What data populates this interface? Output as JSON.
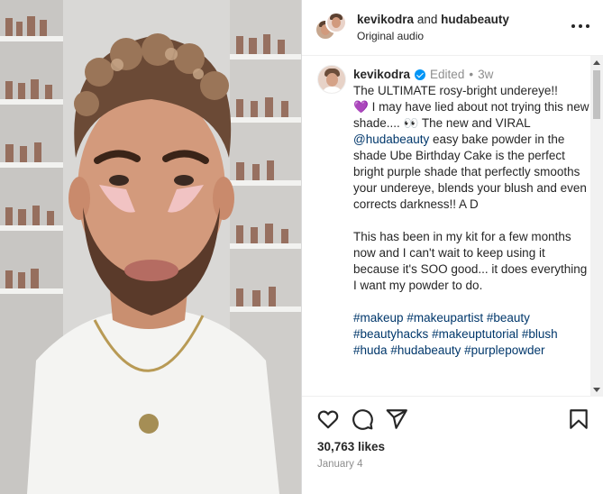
{
  "header": {
    "user1": "kevikodra",
    "connector": "and",
    "user2": "hudabeauty",
    "audio": "Original audio"
  },
  "caption": {
    "username": "kevikodra",
    "edited": "Edited",
    "dot": "•",
    "age": "3w",
    "line1": "The ULTIMATE rosy-bright undereye!!",
    "heart": "💜",
    "line2a": " I may have lied about not trying this new shade.... ",
    "eyes": "👀",
    "line2b": " The new and VIRAL ",
    "mention": "@hudabeauty",
    "line2c": " easy bake powder in the shade Ube Birthday Cake is the perfect bright purple shade that perfectly smooths your undereye, blends your blush and even corrects darkness!! A D",
    "paragraph2": "This has been in my kit for a few months now and I can't wait to keep using it because it's SOO good... it does everything I want my powder to do.",
    "hashtags": [
      "#makeup",
      "#makeupartist",
      "#beauty",
      "#beautyhacks",
      "#makeuptutorial",
      "#blush",
      "#huda",
      "#hudabeauty",
      "#purplepowder"
    ]
  },
  "stats": {
    "likes": "30,763 likes",
    "date": "January 4"
  },
  "icons": {
    "like": "heart-icon",
    "comment": "comment-icon",
    "share": "share-icon",
    "save": "bookmark-icon",
    "more": "more-icon"
  },
  "colors": {
    "link": "#00376b",
    "verified": "#0095f6",
    "muted": "#8e8e8e"
  }
}
